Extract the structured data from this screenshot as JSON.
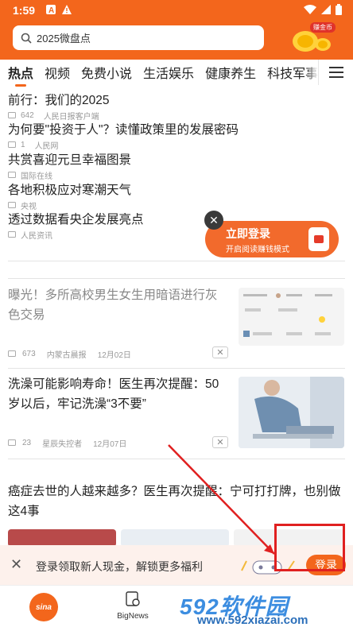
{
  "status": {
    "time": "1:59"
  },
  "search": {
    "placeholder_text": "2025微盘点"
  },
  "gold_badge": "赚金币",
  "tabs": [
    "热点",
    "视频",
    "免费小说",
    "生活娱乐",
    "健康养生",
    "科技军事"
  ],
  "headlines": [
    {
      "title": "前行：我们的2025",
      "count": "642",
      "source": "人民日报客户端"
    },
    {
      "title": "为何要\"投资于人\"？读懂政策里的发展密码",
      "count": "1",
      "source": "人民网"
    },
    {
      "title": "共赏喜迎元旦幸福图景",
      "count": "",
      "source": "国际在线"
    },
    {
      "title": "各地积极应对寒潮天气",
      "count": "",
      "source": "央视"
    },
    {
      "title": "透过数据看央企发展亮点",
      "count": "",
      "source": "人民资讯"
    }
  ],
  "login_bubble": {
    "title": "立即登录",
    "subtitle": "开启阅读赚钱模式",
    "close": "✕"
  },
  "articles": [
    {
      "title_line1": "曝光！多所高校男生女生用暗语进行灰",
      "title_line2": "色交易",
      "count": "673",
      "source": "内蒙古晨报",
      "date": "12月02日",
      "dismiss": "✕"
    },
    {
      "title_line1": "洗澡可能影响寿命！医生再次提醒：50",
      "title_line2": "岁以后，牢记洗澡“3不要”",
      "count": "23",
      "source": "星辰失控者",
      "date": "12月07日",
      "dismiss": "✕"
    },
    {
      "title_line1": "癌症去世的人越来越多？医生再次提醒：宁可打打牌，也别做",
      "title_line2": "这4事"
    }
  ],
  "login_bar": {
    "close": "✕",
    "text": "登录领取新人现金，解锁更多福利",
    "button": "登录"
  },
  "bottom_nav": {
    "home": "sina",
    "bignews": "BigNews"
  },
  "watermark": {
    "big": "592软件园",
    "url": "www.592xiazai.com"
  },
  "colors": {
    "accent": "#f3661c",
    "annotation": "#e02020"
  }
}
